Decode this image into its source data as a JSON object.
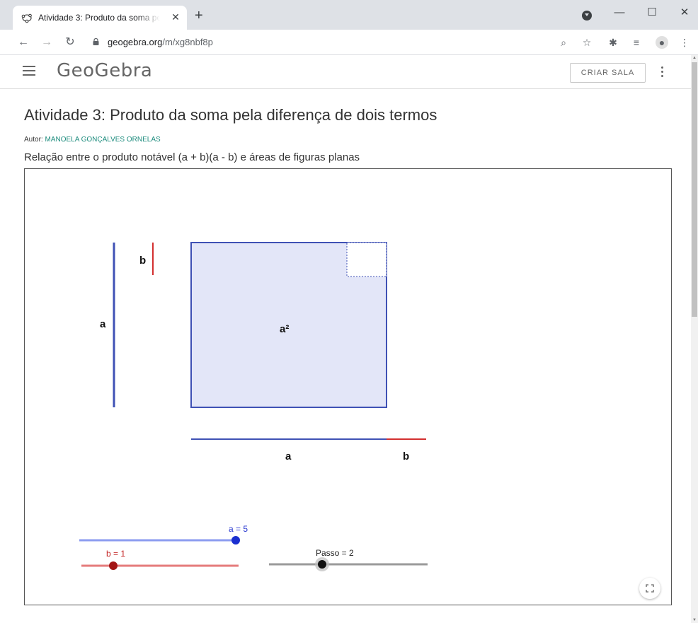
{
  "browser": {
    "tab_title": "Atividade 3: Produto da soma pela diferença de dois termos",
    "url_domain": "geogebra.org",
    "url_path": "/m/xg8nbf8p"
  },
  "header": {
    "logo": "GeoGebra",
    "criar_sala": "CRIAR SALA"
  },
  "activity": {
    "title": "Atividade 3: Produto da soma pela diferença de dois termos",
    "author_label": "Autor:",
    "author_name": "MANOELA GONÇALVES ORNELAS",
    "description": "Relação entre o produto notável (a + b)(a - b) e áreas de figuras planas"
  },
  "applet": {
    "label_b_top": "b",
    "label_a_left": "a",
    "label_area": "a²",
    "label_a_bottom": "a",
    "label_b_bottom": "b",
    "slider_a": {
      "label": "a = 5",
      "value": 5
    },
    "slider_b": {
      "label": "b = 1",
      "value": 1
    },
    "slider_passo": {
      "label": "Passo = 2",
      "value": 2
    },
    "colors": {
      "a": "#3f51b5",
      "b": "#d32f2f",
      "fill": "#e3e6f8"
    }
  }
}
